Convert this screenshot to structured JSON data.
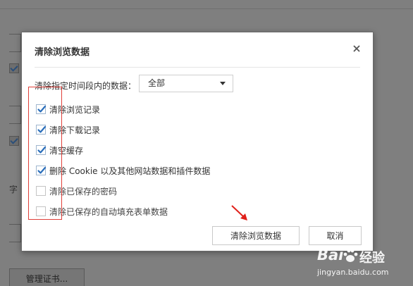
{
  "background": {
    "side_char": "字",
    "manage_cert_button": "管理证书..."
  },
  "dialog": {
    "title": "清除浏览数据",
    "close_icon": "close-icon",
    "range_label": "清除指定时间段内的数据：",
    "range_value": "全部",
    "options": [
      {
        "label": "清除浏览记录",
        "checked": true
      },
      {
        "label": "清除下载记录",
        "checked": true
      },
      {
        "label": "清空缓存",
        "checked": true
      },
      {
        "label": "删除 Cookie 以及其他网站数据和插件数据",
        "checked": true
      },
      {
        "label": "清除已保存的密码",
        "checked": false
      },
      {
        "label": "清除已保存的自动填充表单数据",
        "checked": false
      }
    ],
    "clear_button": "清除浏览数据",
    "cancel_button": "取消"
  },
  "annotation": {
    "highlight_color": "#e0403a",
    "arrow_color": "#e0201a"
  },
  "watermark": {
    "brand": "Bai",
    "brand_suffix": "经验",
    "url": "jingyan.baidu.com"
  },
  "colors": {
    "check_accent": "#2a6ebb",
    "overlay": "#7f7f7f"
  }
}
